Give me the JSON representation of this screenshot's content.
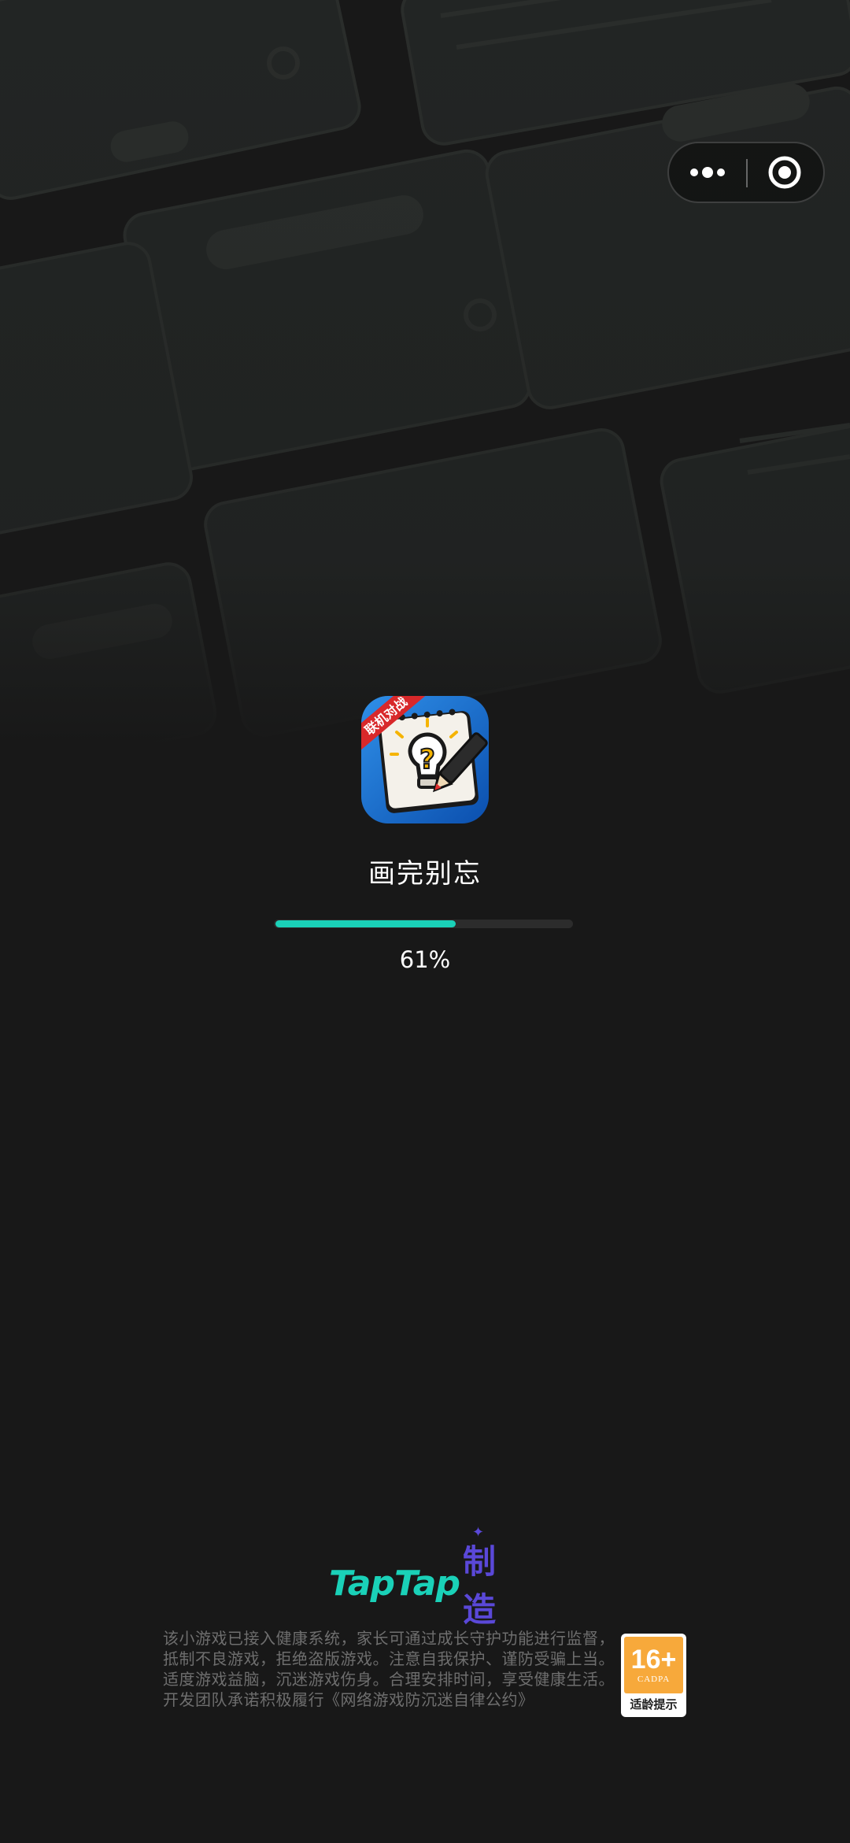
{
  "capsule": {
    "menu_icon": "more-dots-icon",
    "close_icon": "target-circle-icon"
  },
  "app": {
    "name": "画完别忘",
    "icon_banner": "联机对战",
    "icon_name": "lightbulb-notepad-pencil-icon"
  },
  "loading": {
    "progress": 0.61,
    "progress_text": "61%",
    "accent_color": "#1ad1b8"
  },
  "footer": {
    "brand_word": "TapTap",
    "brand_suffix": "制造",
    "notice_lines": [
      "该小游戏已接入健康系统，家长可通过成长守护功能进行监督，",
      "抵制不良游戏，拒绝盗版游戏。注意自我保护、谨防受骗上当。",
      "适度游戏益脑，沉迷游戏伤身。合理安排时间，享受健康生活。",
      "开发团队承诺积极履行《网络游戏防沉迷自律公约》"
    ],
    "age_rating": {
      "number": "16+",
      "org": "CADPA",
      "label": "适龄提示",
      "color": "#f7a93b"
    }
  }
}
